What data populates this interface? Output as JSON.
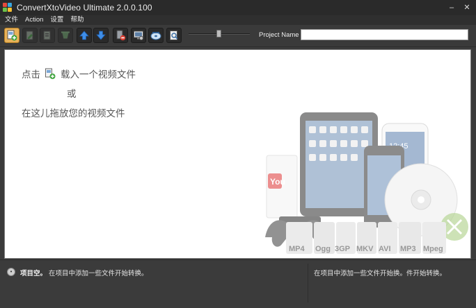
{
  "window": {
    "title": "ConvertXtoVideo Ultimate 2.0.0.100",
    "minimize_glyph": "–",
    "close_glyph": "✕"
  },
  "menu": [
    "文件",
    "Action",
    "设置",
    "帮助"
  ],
  "toolbar": {
    "buttons": [
      {
        "icon": "add-file-icon",
        "active": true
      },
      {
        "icon": "edit-file-icon",
        "active": false
      },
      {
        "icon": "file-settings-icon",
        "active": false
      },
      {
        "icon": "clean-icon",
        "active": false
      },
      {
        "icon": "arrow-up-icon",
        "active": false
      },
      {
        "icon": "arrow-down-icon",
        "active": false
      },
      {
        "icon": "remove-file-icon",
        "active": false
      },
      {
        "icon": "monitor-settings-icon",
        "active": false
      },
      {
        "icon": "burn-disc-icon",
        "active": false
      },
      {
        "icon": "preview-icon",
        "active": false
      }
    ],
    "zoom_slider_value": 0.5,
    "project_name_label": "Project Name",
    "project_name_value": ""
  },
  "workspace": {
    "line1_prefix": "点击",
    "line1_suffix": "载入一个视频文件",
    "line2": "或",
    "line3": "在这儿拖放您的视频文件",
    "format_labels": [
      "MP4",
      "Ogg",
      "3GP",
      "MKV",
      "AVI",
      "MP3",
      "Mpeg"
    ]
  },
  "status": {
    "label": "项目空。",
    "message": "在项目中添加一些文件开始转换。",
    "right_message": "在项目中添加一些文件开始换。件开始转换。"
  },
  "colors": {
    "accent": "#e8b25a",
    "background": "#3b3b3b",
    "workspace": "#ffffff"
  }
}
